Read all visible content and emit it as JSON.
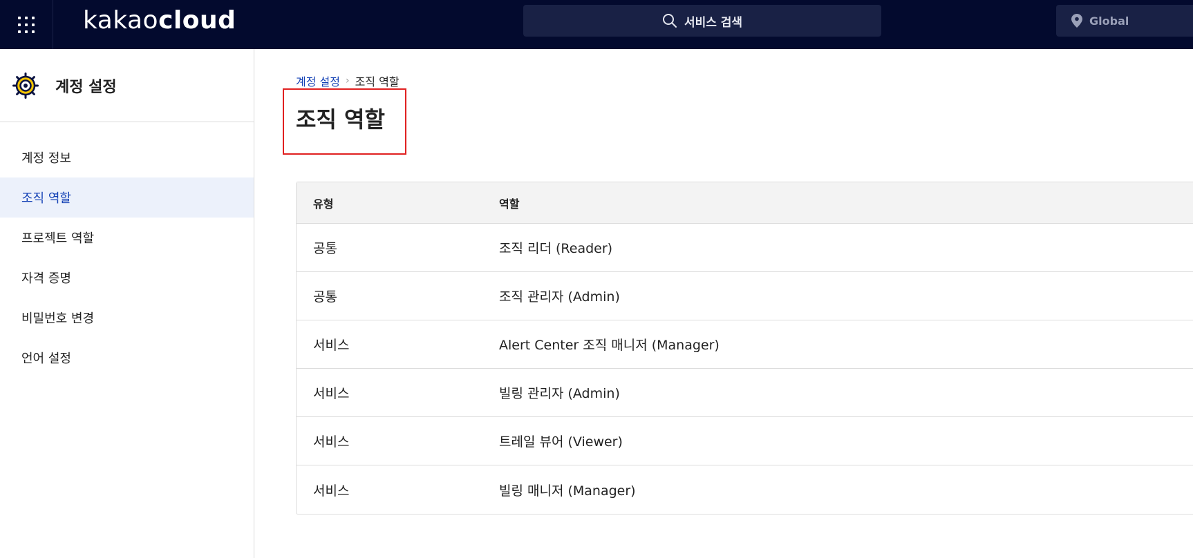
{
  "header": {
    "logo_light": "kakao",
    "logo_bold": "cloud",
    "search_label": "서비스 검색",
    "region_label": "Global"
  },
  "sidebar": {
    "title": "계정 설정",
    "items": [
      {
        "label": "계정 정보"
      },
      {
        "label": "조직 역할"
      },
      {
        "label": "프로젝트 역할"
      },
      {
        "label": "자격 증명"
      },
      {
        "label": "비밀번호 변경"
      },
      {
        "label": "언어 설정"
      }
    ],
    "active_index": 1
  },
  "breadcrumb": {
    "parent": "계정 설정",
    "current": "조직 역할"
  },
  "page": {
    "title": "조직 역할"
  },
  "table": {
    "columns": [
      "유형",
      "역할"
    ],
    "rows": [
      [
        "공통",
        "조직 리더 (Reader)"
      ],
      [
        "공통",
        "조직 관리자 (Admin)"
      ],
      [
        "서비스",
        "Alert Center 조직 매니저 (Manager)"
      ],
      [
        "서비스",
        "빌링 관리자 (Admin)"
      ],
      [
        "서비스",
        "트레일 뷰어 (Viewer)"
      ],
      [
        "서비스",
        "빌링 매니저 (Manager)"
      ]
    ]
  },
  "colors": {
    "topbar": "#030a2e",
    "accent": "#1542b5",
    "highlight_box": "#e02020",
    "gear_icon": "#f5c400"
  },
  "icons": [
    "apps-grid-icon",
    "search-icon",
    "location-pin-icon",
    "gear-icon"
  ]
}
